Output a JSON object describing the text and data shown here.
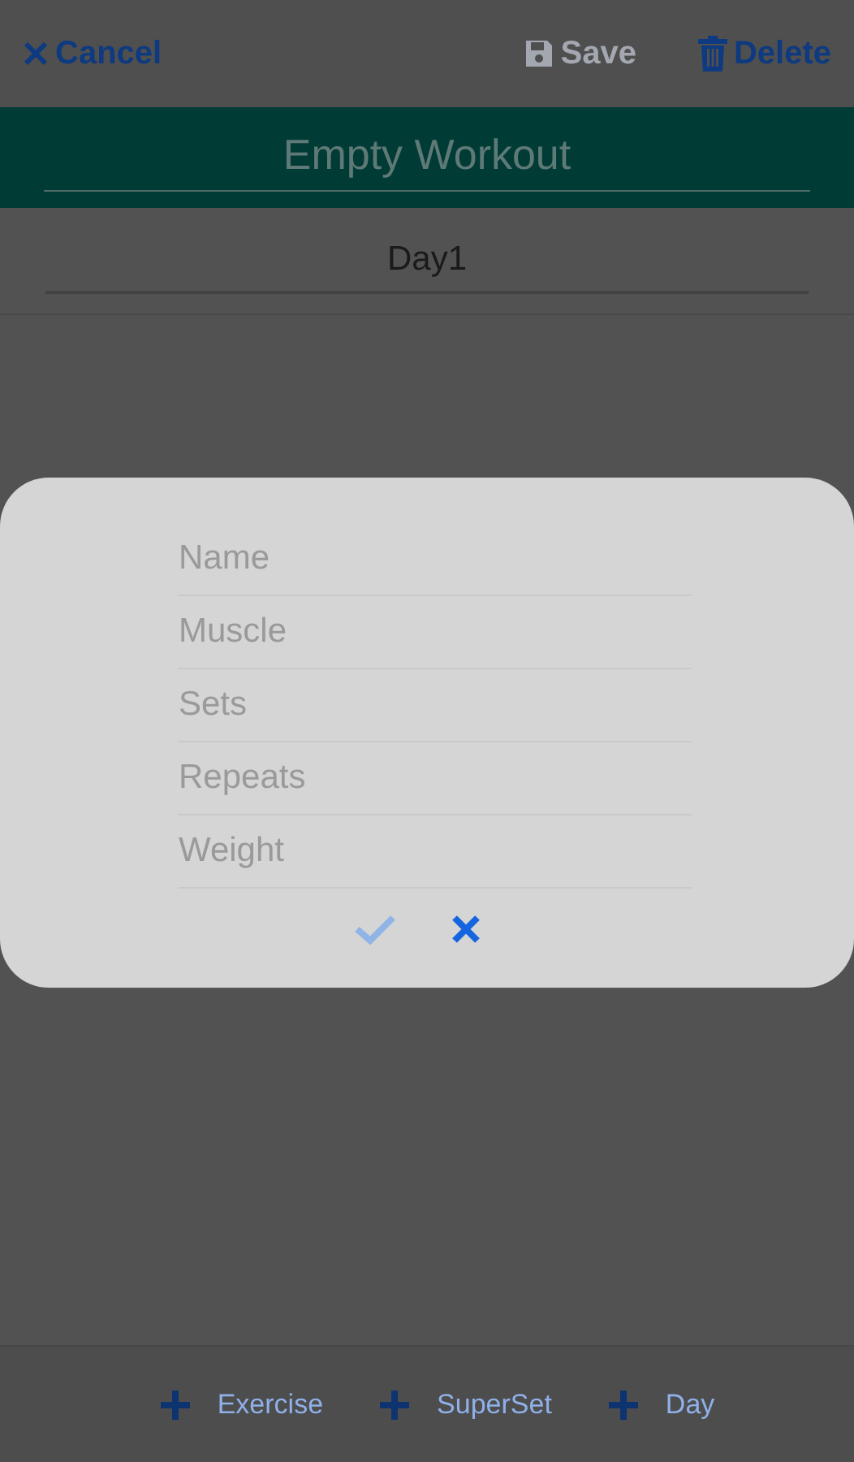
{
  "toolbar": [
    {
      "kind": "cancel",
      "label": "Cancel",
      "disabled": false
    },
    {
      "kind": "save",
      "label": "Save",
      "disabled": true
    },
    {
      "kind": "delete",
      "label": "Delete",
      "disabled": false
    }
  ],
  "workout": {
    "title": "Empty Workout"
  },
  "day": {
    "name": "Day1"
  },
  "dialog": {
    "fields": [
      {
        "placeholder": "Name"
      },
      {
        "placeholder": "Muscle"
      },
      {
        "placeholder": "Sets"
      },
      {
        "placeholder": "Repeats"
      },
      {
        "placeholder": "Weight"
      }
    ],
    "actions": [
      {
        "kind": "confirm",
        "disabled": true
      },
      {
        "kind": "cancel",
        "disabled": false
      }
    ]
  },
  "bottom_actions": [
    {
      "label": "Exercise"
    },
    {
      "label": "SuperSet"
    },
    {
      "label": "Day"
    }
  ]
}
